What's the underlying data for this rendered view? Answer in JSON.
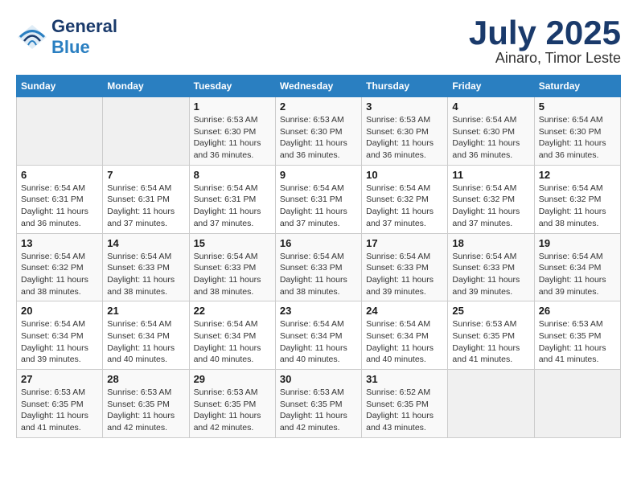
{
  "header": {
    "logo_text_general": "General",
    "logo_text_blue": "Blue",
    "month_year": "July 2025",
    "location": "Ainaro, Timor Leste"
  },
  "weekdays": [
    "Sunday",
    "Monday",
    "Tuesday",
    "Wednesday",
    "Thursday",
    "Friday",
    "Saturday"
  ],
  "weeks": [
    [
      {
        "day": "",
        "info": ""
      },
      {
        "day": "",
        "info": ""
      },
      {
        "day": "1",
        "info": "Sunrise: 6:53 AM\nSunset: 6:30 PM\nDaylight: 11 hours and 36 minutes."
      },
      {
        "day": "2",
        "info": "Sunrise: 6:53 AM\nSunset: 6:30 PM\nDaylight: 11 hours and 36 minutes."
      },
      {
        "day": "3",
        "info": "Sunrise: 6:53 AM\nSunset: 6:30 PM\nDaylight: 11 hours and 36 minutes."
      },
      {
        "day": "4",
        "info": "Sunrise: 6:54 AM\nSunset: 6:30 PM\nDaylight: 11 hours and 36 minutes."
      },
      {
        "day": "5",
        "info": "Sunrise: 6:54 AM\nSunset: 6:30 PM\nDaylight: 11 hours and 36 minutes."
      }
    ],
    [
      {
        "day": "6",
        "info": "Sunrise: 6:54 AM\nSunset: 6:31 PM\nDaylight: 11 hours and 36 minutes."
      },
      {
        "day": "7",
        "info": "Sunrise: 6:54 AM\nSunset: 6:31 PM\nDaylight: 11 hours and 37 minutes."
      },
      {
        "day": "8",
        "info": "Sunrise: 6:54 AM\nSunset: 6:31 PM\nDaylight: 11 hours and 37 minutes."
      },
      {
        "day": "9",
        "info": "Sunrise: 6:54 AM\nSunset: 6:31 PM\nDaylight: 11 hours and 37 minutes."
      },
      {
        "day": "10",
        "info": "Sunrise: 6:54 AM\nSunset: 6:32 PM\nDaylight: 11 hours and 37 minutes."
      },
      {
        "day": "11",
        "info": "Sunrise: 6:54 AM\nSunset: 6:32 PM\nDaylight: 11 hours and 37 minutes."
      },
      {
        "day": "12",
        "info": "Sunrise: 6:54 AM\nSunset: 6:32 PM\nDaylight: 11 hours and 38 minutes."
      }
    ],
    [
      {
        "day": "13",
        "info": "Sunrise: 6:54 AM\nSunset: 6:32 PM\nDaylight: 11 hours and 38 minutes."
      },
      {
        "day": "14",
        "info": "Sunrise: 6:54 AM\nSunset: 6:33 PM\nDaylight: 11 hours and 38 minutes."
      },
      {
        "day": "15",
        "info": "Sunrise: 6:54 AM\nSunset: 6:33 PM\nDaylight: 11 hours and 38 minutes."
      },
      {
        "day": "16",
        "info": "Sunrise: 6:54 AM\nSunset: 6:33 PM\nDaylight: 11 hours and 38 minutes."
      },
      {
        "day": "17",
        "info": "Sunrise: 6:54 AM\nSunset: 6:33 PM\nDaylight: 11 hours and 39 minutes."
      },
      {
        "day": "18",
        "info": "Sunrise: 6:54 AM\nSunset: 6:33 PM\nDaylight: 11 hours and 39 minutes."
      },
      {
        "day": "19",
        "info": "Sunrise: 6:54 AM\nSunset: 6:34 PM\nDaylight: 11 hours and 39 minutes."
      }
    ],
    [
      {
        "day": "20",
        "info": "Sunrise: 6:54 AM\nSunset: 6:34 PM\nDaylight: 11 hours and 39 minutes."
      },
      {
        "day": "21",
        "info": "Sunrise: 6:54 AM\nSunset: 6:34 PM\nDaylight: 11 hours and 40 minutes."
      },
      {
        "day": "22",
        "info": "Sunrise: 6:54 AM\nSunset: 6:34 PM\nDaylight: 11 hours and 40 minutes."
      },
      {
        "day": "23",
        "info": "Sunrise: 6:54 AM\nSunset: 6:34 PM\nDaylight: 11 hours and 40 minutes."
      },
      {
        "day": "24",
        "info": "Sunrise: 6:54 AM\nSunset: 6:34 PM\nDaylight: 11 hours and 40 minutes."
      },
      {
        "day": "25",
        "info": "Sunrise: 6:53 AM\nSunset: 6:35 PM\nDaylight: 11 hours and 41 minutes."
      },
      {
        "day": "26",
        "info": "Sunrise: 6:53 AM\nSunset: 6:35 PM\nDaylight: 11 hours and 41 minutes."
      }
    ],
    [
      {
        "day": "27",
        "info": "Sunrise: 6:53 AM\nSunset: 6:35 PM\nDaylight: 11 hours and 41 minutes."
      },
      {
        "day": "28",
        "info": "Sunrise: 6:53 AM\nSunset: 6:35 PM\nDaylight: 11 hours and 42 minutes."
      },
      {
        "day": "29",
        "info": "Sunrise: 6:53 AM\nSunset: 6:35 PM\nDaylight: 11 hours and 42 minutes."
      },
      {
        "day": "30",
        "info": "Sunrise: 6:53 AM\nSunset: 6:35 PM\nDaylight: 11 hours and 42 minutes."
      },
      {
        "day": "31",
        "info": "Sunrise: 6:52 AM\nSunset: 6:35 PM\nDaylight: 11 hours and 43 minutes."
      },
      {
        "day": "",
        "info": ""
      },
      {
        "day": "",
        "info": ""
      }
    ]
  ]
}
